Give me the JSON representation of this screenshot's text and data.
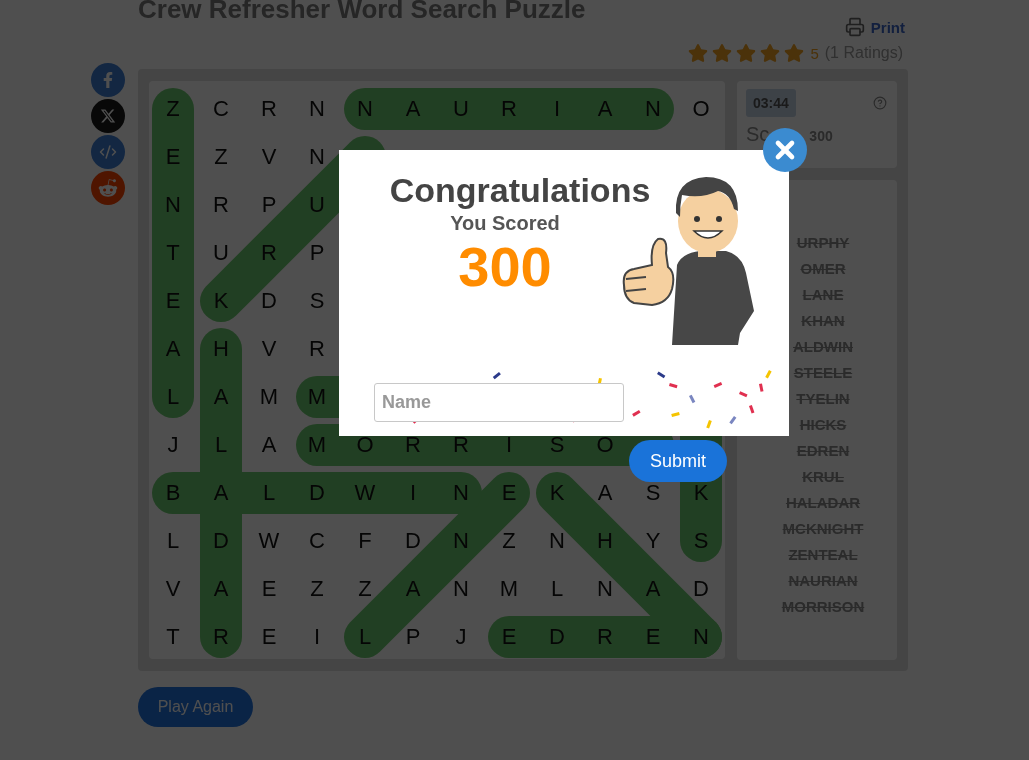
{
  "title": "Crew Refresher Word Search Puzzle",
  "print": {
    "label": "Print"
  },
  "rating": {
    "stars": 5,
    "score": "5",
    "count": "(1 Ratings)"
  },
  "share_buttons": [
    {
      "kind": "facebook"
    },
    {
      "kind": "x"
    },
    {
      "kind": "embed"
    },
    {
      "kind": "reddit"
    }
  ],
  "grid": {
    "rows": [
      [
        "Z",
        "C",
        "R",
        "N",
        "N",
        "A",
        "U",
        "R",
        "I",
        "A",
        "N",
        "O"
      ],
      [
        "E",
        "Z",
        "V",
        "N",
        null,
        null,
        null,
        null,
        null,
        null,
        null,
        null
      ],
      [
        "N",
        "R",
        "P",
        "U",
        null,
        null,
        null,
        null,
        null,
        null,
        null,
        null
      ],
      [
        "T",
        "U",
        "R",
        "P",
        null,
        null,
        null,
        null,
        null,
        null,
        null,
        null
      ],
      [
        "E",
        "K",
        "D",
        "S",
        null,
        null,
        null,
        null,
        null,
        null,
        null,
        null
      ],
      [
        "A",
        "H",
        "V",
        "R",
        null,
        null,
        null,
        null,
        null,
        null,
        null,
        null
      ],
      [
        "L",
        "A",
        "M",
        "M",
        null,
        null,
        null,
        null,
        null,
        null,
        null,
        null
      ],
      [
        "J",
        "L",
        "A",
        "M",
        "O",
        "R",
        "R",
        "I",
        "S",
        "O",
        null,
        null
      ],
      [
        "B",
        "A",
        "L",
        "D",
        "W",
        "I",
        "N",
        "E",
        "K",
        "A",
        "S",
        "K"
      ],
      [
        "L",
        "D",
        "W",
        "C",
        "F",
        "D",
        "N",
        "Z",
        "N",
        "H",
        "Y",
        "S"
      ],
      [
        "V",
        "A",
        "E",
        "Z",
        "Z",
        "A",
        "N",
        "M",
        "L",
        "N",
        "A",
        "D"
      ],
      [
        "T",
        "R",
        "E",
        "I",
        "L",
        "P",
        "J",
        "E",
        "D",
        "R",
        "E",
        "N"
      ]
    ]
  },
  "timer": "03:44",
  "score": {
    "label": "Sc",
    "value": "300"
  },
  "words": [
    {
      "text": "URPHY",
      "found": true
    },
    {
      "text": "OMER",
      "found": true
    },
    {
      "text": "LANE",
      "found": true
    },
    {
      "text": "KHAN",
      "found": true
    },
    {
      "text": "ALDWIN",
      "found": true
    },
    {
      "text": "STEELE",
      "found": true
    },
    {
      "text": "TYELIN",
      "found": true
    },
    {
      "text": "HICKS",
      "found": true
    },
    {
      "text": "EDREN",
      "found": true
    },
    {
      "text": "KRUL",
      "found": true
    },
    {
      "text": "HALADAR",
      "found": true
    },
    {
      "text": "MCKNIGHT",
      "found": true
    },
    {
      "text": "ZENTEAL",
      "found": true
    },
    {
      "text": "NAURIAN",
      "found": true
    },
    {
      "text": "MORRISON",
      "found": true
    }
  ],
  "play_again": "Play Again",
  "modal": {
    "title": "Congratulations",
    "subtitle": "You Scored",
    "score": "300",
    "name_field": {
      "placeholder": "Name"
    },
    "submit": "Submit"
  }
}
